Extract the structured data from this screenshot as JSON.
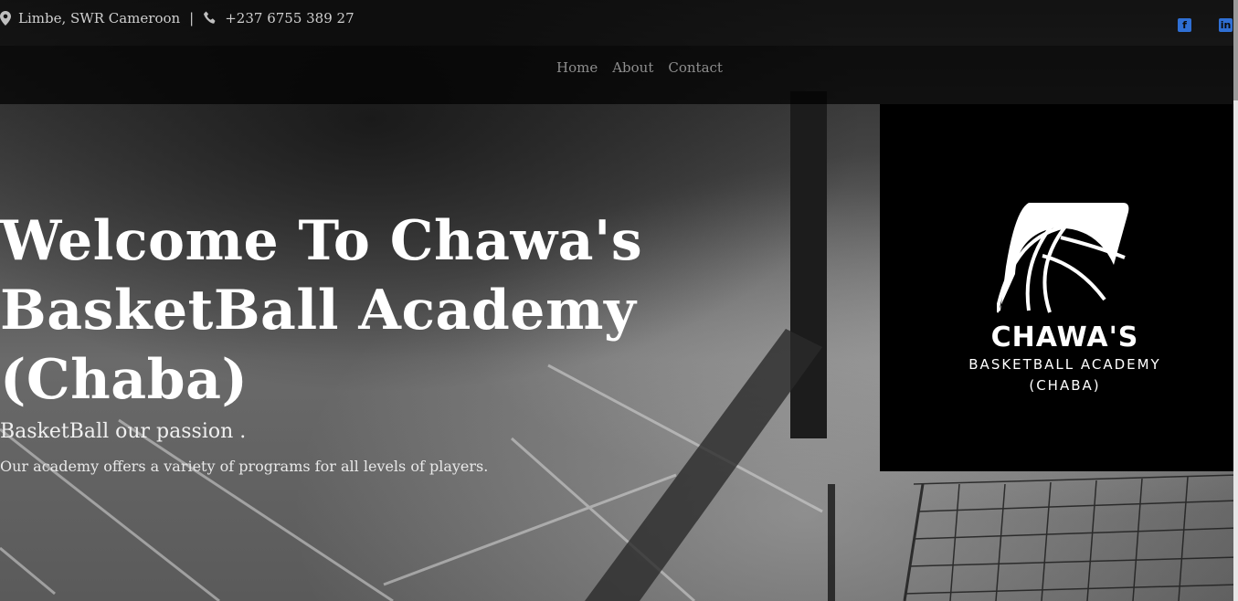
{
  "topbar": {
    "location": "Limbe, SWR Cameroon",
    "separator": "|",
    "phone": "+237 6755 389 27",
    "social": [
      {
        "name": "facebook-icon",
        "glyph": "f"
      },
      {
        "name": "linkedin-icon",
        "glyph": "in"
      }
    ],
    "icon_color": "#2f6fd4"
  },
  "nav": {
    "items": [
      "Home",
      "About",
      "Contact"
    ]
  },
  "hero": {
    "title": "Welcome To Chawa's BasketBall Academy (Chaba)",
    "tagline": "BasketBall our passion .",
    "description": "Our academy offers a variety of programs for all levels of players."
  },
  "logo": {
    "title": "CHAWA'S",
    "subtitle1": "BASKETBALL ACADEMY",
    "subtitle2": "(CHABA)"
  }
}
